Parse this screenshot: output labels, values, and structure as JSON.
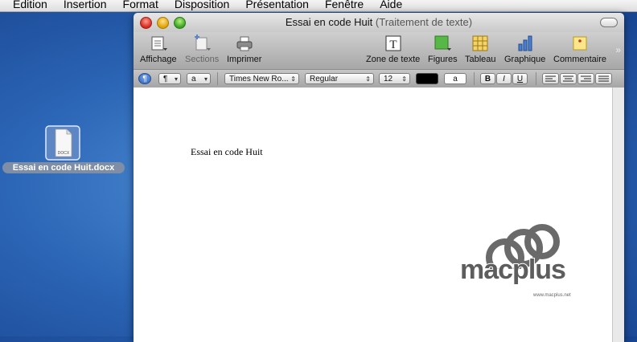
{
  "menubar": {
    "items": [
      "Edition",
      "Insertion",
      "Format",
      "Disposition",
      "Présentation",
      "Fenêtre",
      "Aide"
    ]
  },
  "desktop": {
    "file_label": "Essai en code Huit.docx",
    "file_badge": "DOCX"
  },
  "window": {
    "title": "Essai en code Huit",
    "subtitle": "(Traitement de texte)",
    "toolbar": {
      "affichage": "Affichage",
      "sections": "Sections",
      "imprimer": "Imprimer",
      "zone_texte": "Zone de texte",
      "figures": "Figures",
      "tableau": "Tableau",
      "graphique": "Graphique",
      "commentaire": "Commentaire",
      "overflow": "»"
    },
    "format_bar": {
      "paragraph_style": "¶",
      "char_style": "a",
      "font": "Times New Ro...",
      "font_style": "Regular",
      "size": "12",
      "text_color": "#000000",
      "highlight_label": "a",
      "bold": "B",
      "italic": "I",
      "underline": "U"
    },
    "document": {
      "body_text": "Essai en code Huit",
      "watermark_logo": "macplus",
      "watermark_url": "www.macplus.net"
    }
  },
  "colors": {
    "desktop": "#2c66b6",
    "accent_blue": "#2b6fce"
  }
}
